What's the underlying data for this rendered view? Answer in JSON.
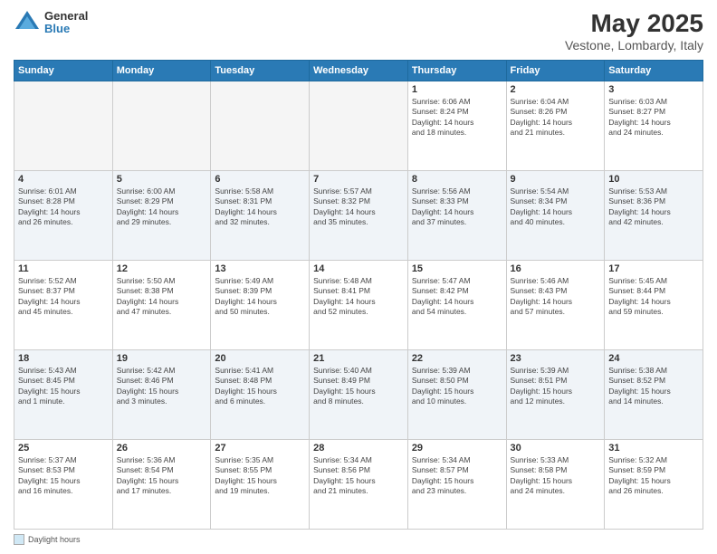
{
  "header": {
    "logo": {
      "general": "General",
      "blue": "Blue"
    },
    "title": "May 2025",
    "location": "Vestone, Lombardy, Italy"
  },
  "days_of_week": [
    "Sunday",
    "Monday",
    "Tuesday",
    "Wednesday",
    "Thursday",
    "Friday",
    "Saturday"
  ],
  "weeks": [
    [
      {
        "day": "",
        "info": ""
      },
      {
        "day": "",
        "info": ""
      },
      {
        "day": "",
        "info": ""
      },
      {
        "day": "",
        "info": ""
      },
      {
        "day": "1",
        "info": "Sunrise: 6:06 AM\nSunset: 8:24 PM\nDaylight: 14 hours\nand 18 minutes."
      },
      {
        "day": "2",
        "info": "Sunrise: 6:04 AM\nSunset: 8:26 PM\nDaylight: 14 hours\nand 21 minutes."
      },
      {
        "day": "3",
        "info": "Sunrise: 6:03 AM\nSunset: 8:27 PM\nDaylight: 14 hours\nand 24 minutes."
      }
    ],
    [
      {
        "day": "4",
        "info": "Sunrise: 6:01 AM\nSunset: 8:28 PM\nDaylight: 14 hours\nand 26 minutes."
      },
      {
        "day": "5",
        "info": "Sunrise: 6:00 AM\nSunset: 8:29 PM\nDaylight: 14 hours\nand 29 minutes."
      },
      {
        "day": "6",
        "info": "Sunrise: 5:58 AM\nSunset: 8:31 PM\nDaylight: 14 hours\nand 32 minutes."
      },
      {
        "day": "7",
        "info": "Sunrise: 5:57 AM\nSunset: 8:32 PM\nDaylight: 14 hours\nand 35 minutes."
      },
      {
        "day": "8",
        "info": "Sunrise: 5:56 AM\nSunset: 8:33 PM\nDaylight: 14 hours\nand 37 minutes."
      },
      {
        "day": "9",
        "info": "Sunrise: 5:54 AM\nSunset: 8:34 PM\nDaylight: 14 hours\nand 40 minutes."
      },
      {
        "day": "10",
        "info": "Sunrise: 5:53 AM\nSunset: 8:36 PM\nDaylight: 14 hours\nand 42 minutes."
      }
    ],
    [
      {
        "day": "11",
        "info": "Sunrise: 5:52 AM\nSunset: 8:37 PM\nDaylight: 14 hours\nand 45 minutes."
      },
      {
        "day": "12",
        "info": "Sunrise: 5:50 AM\nSunset: 8:38 PM\nDaylight: 14 hours\nand 47 minutes."
      },
      {
        "day": "13",
        "info": "Sunrise: 5:49 AM\nSunset: 8:39 PM\nDaylight: 14 hours\nand 50 minutes."
      },
      {
        "day": "14",
        "info": "Sunrise: 5:48 AM\nSunset: 8:41 PM\nDaylight: 14 hours\nand 52 minutes."
      },
      {
        "day": "15",
        "info": "Sunrise: 5:47 AM\nSunset: 8:42 PM\nDaylight: 14 hours\nand 54 minutes."
      },
      {
        "day": "16",
        "info": "Sunrise: 5:46 AM\nSunset: 8:43 PM\nDaylight: 14 hours\nand 57 minutes."
      },
      {
        "day": "17",
        "info": "Sunrise: 5:45 AM\nSunset: 8:44 PM\nDaylight: 14 hours\nand 59 minutes."
      }
    ],
    [
      {
        "day": "18",
        "info": "Sunrise: 5:43 AM\nSunset: 8:45 PM\nDaylight: 15 hours\nand 1 minute."
      },
      {
        "day": "19",
        "info": "Sunrise: 5:42 AM\nSunset: 8:46 PM\nDaylight: 15 hours\nand 3 minutes."
      },
      {
        "day": "20",
        "info": "Sunrise: 5:41 AM\nSunset: 8:48 PM\nDaylight: 15 hours\nand 6 minutes."
      },
      {
        "day": "21",
        "info": "Sunrise: 5:40 AM\nSunset: 8:49 PM\nDaylight: 15 hours\nand 8 minutes."
      },
      {
        "day": "22",
        "info": "Sunrise: 5:39 AM\nSunset: 8:50 PM\nDaylight: 15 hours\nand 10 minutes."
      },
      {
        "day": "23",
        "info": "Sunrise: 5:39 AM\nSunset: 8:51 PM\nDaylight: 15 hours\nand 12 minutes."
      },
      {
        "day": "24",
        "info": "Sunrise: 5:38 AM\nSunset: 8:52 PM\nDaylight: 15 hours\nand 14 minutes."
      }
    ],
    [
      {
        "day": "25",
        "info": "Sunrise: 5:37 AM\nSunset: 8:53 PM\nDaylight: 15 hours\nand 16 minutes."
      },
      {
        "day": "26",
        "info": "Sunrise: 5:36 AM\nSunset: 8:54 PM\nDaylight: 15 hours\nand 17 minutes."
      },
      {
        "day": "27",
        "info": "Sunrise: 5:35 AM\nSunset: 8:55 PM\nDaylight: 15 hours\nand 19 minutes."
      },
      {
        "day": "28",
        "info": "Sunrise: 5:34 AM\nSunset: 8:56 PM\nDaylight: 15 hours\nand 21 minutes."
      },
      {
        "day": "29",
        "info": "Sunrise: 5:34 AM\nSunset: 8:57 PM\nDaylight: 15 hours\nand 23 minutes."
      },
      {
        "day": "30",
        "info": "Sunrise: 5:33 AM\nSunset: 8:58 PM\nDaylight: 15 hours\nand 24 minutes."
      },
      {
        "day": "31",
        "info": "Sunrise: 5:32 AM\nSunset: 8:59 PM\nDaylight: 15 hours\nand 26 minutes."
      }
    ]
  ],
  "footer": {
    "legend_label": "Daylight hours"
  }
}
